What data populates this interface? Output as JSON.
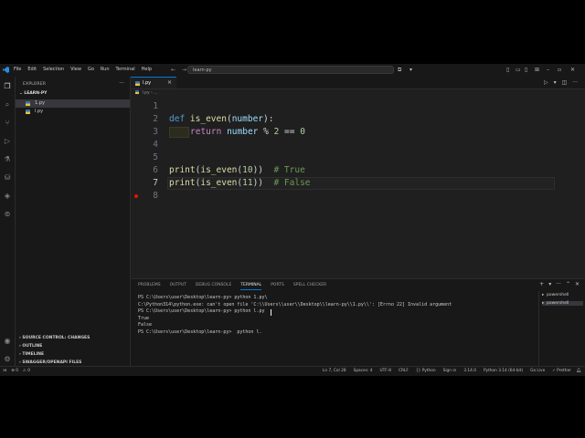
{
  "menu": [
    "File",
    "Edit",
    "Selection",
    "View",
    "Go",
    "Run",
    "Terminal",
    "Help"
  ],
  "search": {
    "text": "learn-py"
  },
  "explorer": {
    "title": "EXPLORER",
    "folder": "LEARN-PY",
    "files": [
      "1.py",
      "l.py"
    ],
    "sections": [
      "SOURCE CONTROL: CHANGES",
      "OUTLINE",
      "TIMELINE",
      "SWAGGER/OPENAPI FILES"
    ]
  },
  "tab": {
    "name": "l.py",
    "close": "×"
  },
  "breadcrumb": "l.py › ...",
  "editor": {
    "line_numbers": [
      "1",
      "2",
      "3",
      "4",
      "5",
      "6",
      "7",
      "8"
    ],
    "l2": {
      "kw": "def",
      "fn": "is_even",
      "open": "(",
      "param": "number",
      "close": "):"
    },
    "l3": {
      "kw": "return",
      "param": "number",
      "rest": " % ",
      "n1": "2",
      "eq": " == ",
      "n2": "0"
    },
    "l6": {
      "fn1": "print",
      "p1": "(",
      "fn2": "is_even",
      "p2": "(",
      "num": "10",
      "p3": "))",
      "cm": "  # True"
    },
    "l7": {
      "fn1": "print",
      "p1": "(",
      "fn2": "is_even",
      "p2": "(",
      "num": "11",
      "p3": "))",
      "cm": "  # False"
    }
  },
  "panel": {
    "tabs": [
      "PROBLEMS",
      "OUTPUT",
      "DEBUG CONSOLE",
      "TERMINAL",
      "PORTS",
      "SPELL CHECKER"
    ],
    "active_tab": "TERMINAL",
    "terminal_lines": [
      "PS C:\\Users\\user\\Desktop\\learn-py> python 1.py\\",
      "C:\\Python314\\python.exe: can't open file 'C:\\\\Users\\\\user\\\\Desktop\\\\learn-py\\\\1.py\\\\': [Errno 22] Invalid argument",
      "PS C:\\Users\\user\\Desktop\\learn-py> python l.py",
      "True",
      "False",
      "PS C:\\Users\\user\\Desktop\\learn-py>  python l."
    ],
    "shells": [
      "powershell",
      "powershell"
    ]
  },
  "status": {
    "left": [
      "⊗ 0",
      "⚠ 0"
    ],
    "right": [
      "Ln 7, Col 28",
      "Spaces: 4",
      "UTF-8",
      "CRLF",
      "{} Python",
      "Sign in",
      "3.14.0",
      "Python 3.14 (64-bit)",
      "Go Live",
      "✓ Prettier"
    ]
  },
  "colors": {
    "accent": "#0078d4",
    "breakpoint": "#e51400",
    "keyword": "#c586c0",
    "function": "#dcdcaa",
    "param": "#9cdcfe",
    "number": "#b5cea8",
    "comment": "#6a9955"
  }
}
